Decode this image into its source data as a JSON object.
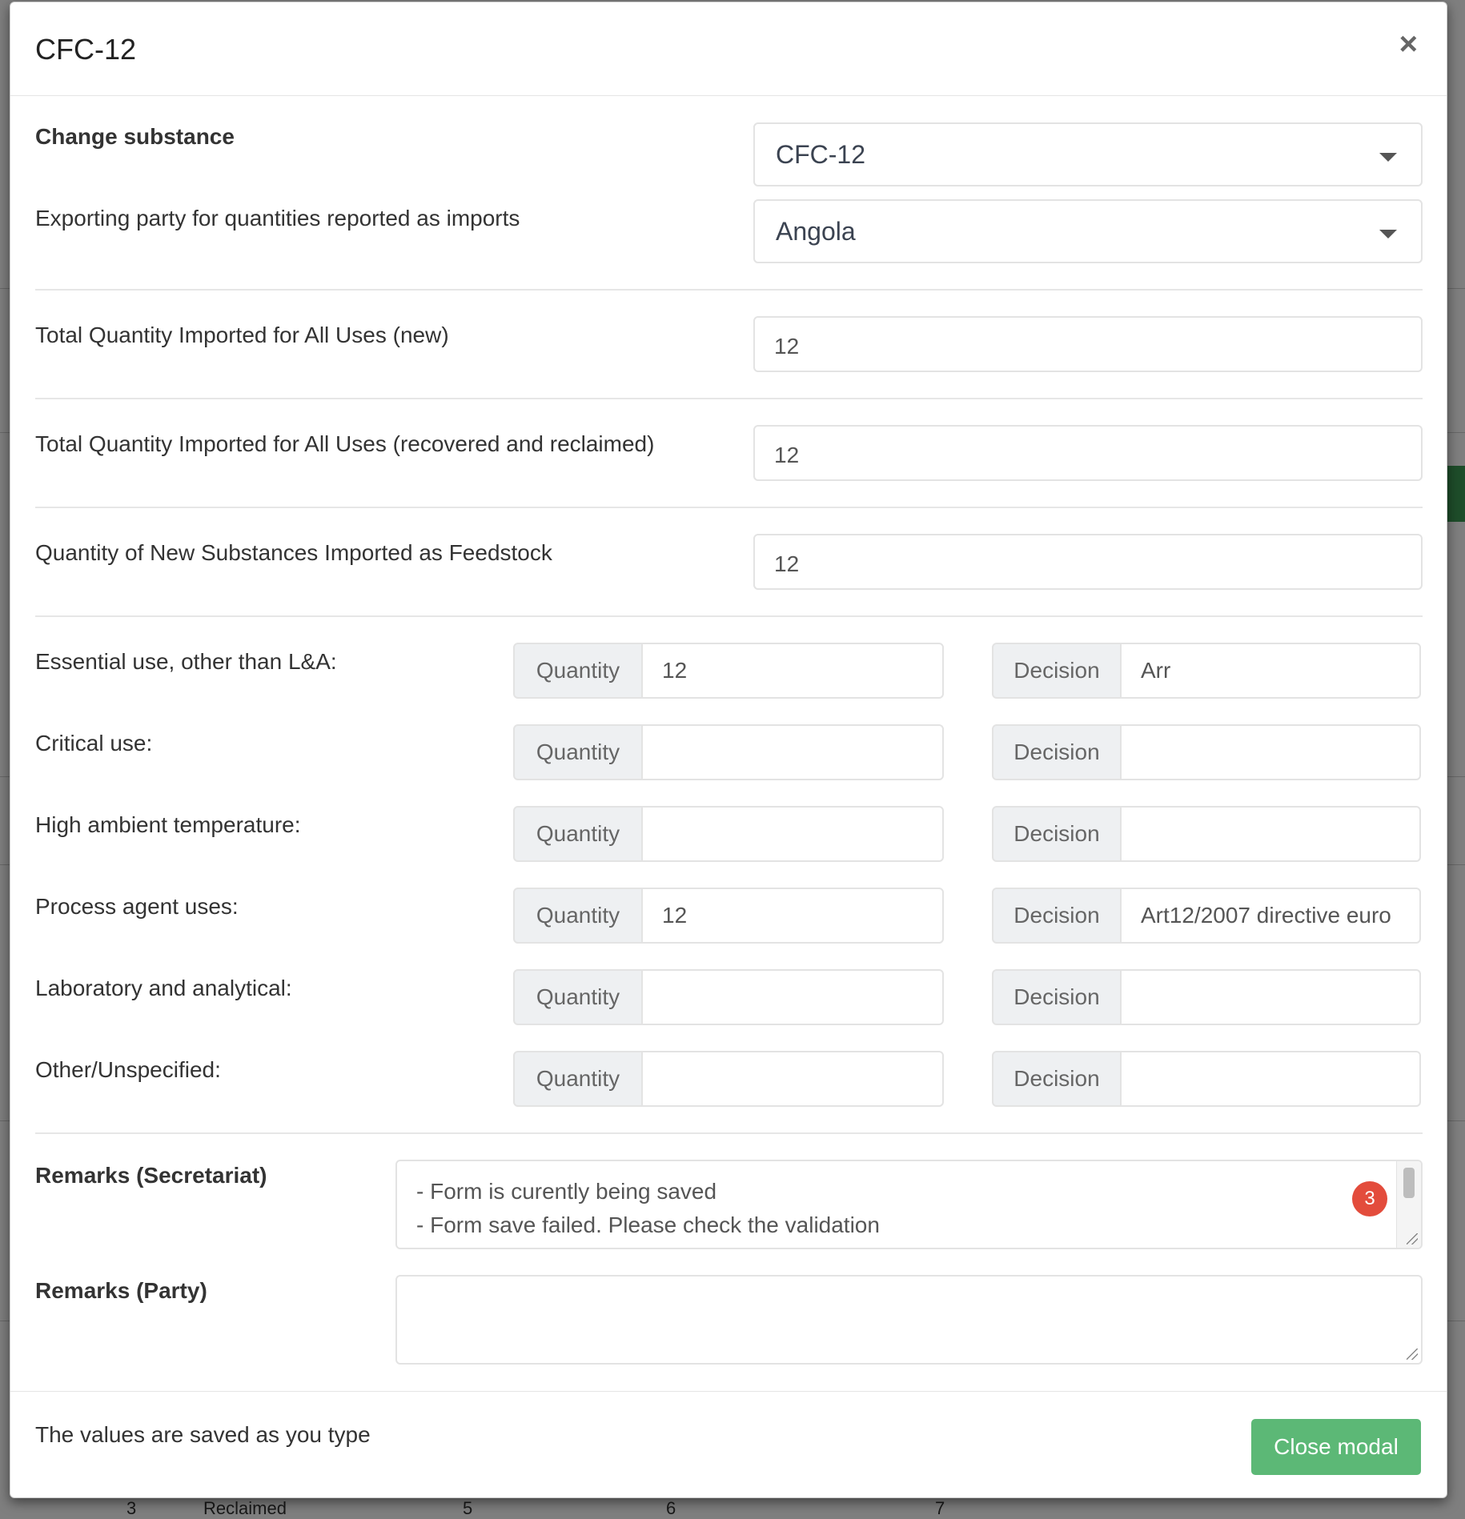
{
  "modal": {
    "title": "CFC-12",
    "close_icon": "×",
    "change_substance_label": "Change substance",
    "change_substance_value": "CFC-12",
    "exporting_party_label": "Exporting party for quantities reported as imports",
    "exporting_party_value": "Angola",
    "fields": [
      {
        "label": "Total Quantity Imported for All Uses (new)",
        "value": "12"
      },
      {
        "label": "Total Quantity Imported for All Uses (recovered and reclaimed)",
        "value": "12"
      },
      {
        "label": "Quantity of New Substances Imported as Feedstock",
        "value": "12"
      }
    ],
    "quantity_addon": "Quantity",
    "decision_addon": "Decision",
    "uses": [
      {
        "label": "Essential use, other than L&A:",
        "quantity": "12",
        "decision": "Arr"
      },
      {
        "label": "Critical use:",
        "quantity": "",
        "decision": ""
      },
      {
        "label": "High ambient temperature:",
        "quantity": "",
        "decision": ""
      },
      {
        "label": "Process agent uses:",
        "quantity": "12",
        "decision": "Art12/2007 directive euro"
      },
      {
        "label": "Laboratory and analytical:",
        "quantity": "",
        "decision": ""
      },
      {
        "label": "Other/Unspecified:",
        "quantity": "",
        "decision": ""
      }
    ],
    "remarks_secretariat_label": "Remarks (Secretariat)",
    "remarks_secretariat_lines": [
      "- Form is curently being saved",
      " - Form save failed. Please check the validation"
    ],
    "remarks_badge": "3",
    "remarks_party_label": "Remarks (Party)",
    "remarks_party_value": "",
    "footer_note": "The values are saved as you type",
    "close_button": "Close modal"
  },
  "background": {
    "bottom_row": [
      "3",
      "Reclaimed",
      "5",
      "6",
      "7"
    ]
  },
  "colors": {
    "close_button": "#5cb876",
    "badge": "#e34c3c"
  }
}
